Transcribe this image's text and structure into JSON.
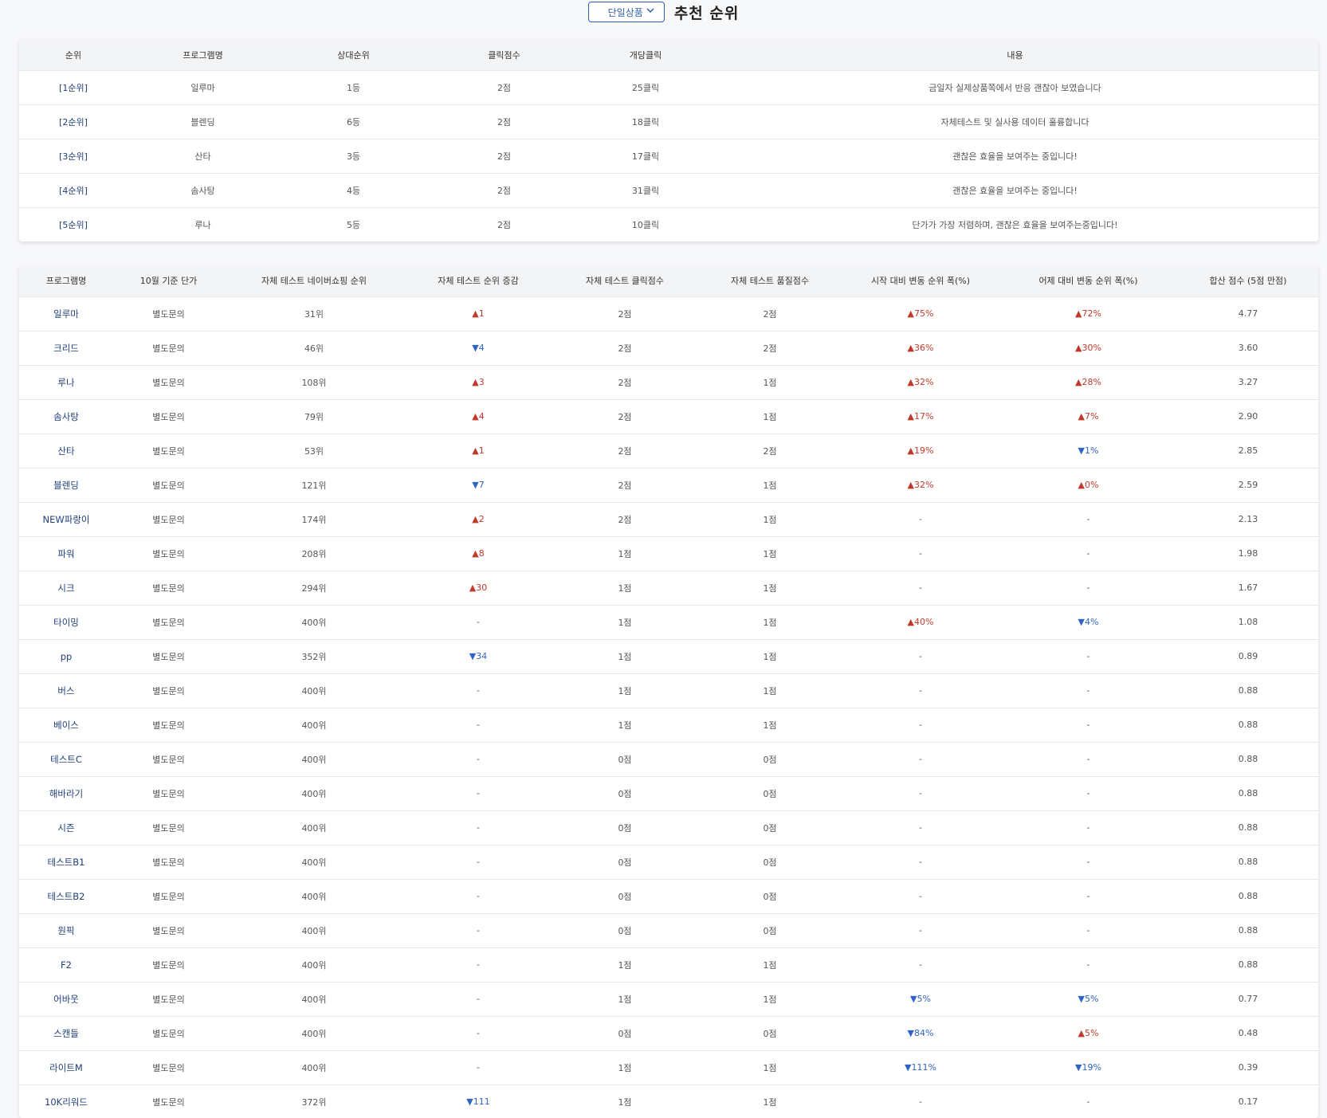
{
  "header": {
    "dropdown_label": "단일상품",
    "title": "추천 순위"
  },
  "top_table": {
    "columns": [
      "순위",
      "프로그램명",
      "상대순위",
      "클릭점수",
      "개당클릭",
      "내용"
    ],
    "rows": [
      [
        "[1순위]",
        "일루마",
        "1등",
        "2점",
        "25클릭",
        "금일자 실제상품쪽에서 반응 괜찮아 보였습니다"
      ],
      [
        "[2순위]",
        "블렌딩",
        "6등",
        "2점",
        "18클릭",
        "자체테스트 및 실사용 데이터 훌륭합니다"
      ],
      [
        "[3순위]",
        "산타",
        "3등",
        "2점",
        "17클릭",
        "괜찮은 효율을 보여주는 중입니다!"
      ],
      [
        "[4순위]",
        "솜사탕",
        "4등",
        "2점",
        "31클릭",
        "괜찮은 효율을 보여주는 중입니다!"
      ],
      [
        "[5순위]",
        "루나",
        "5등",
        "2점",
        "10클릭",
        "단가가 가장 저렴하며, 괜찮은 효율을 보여주는중입니다!"
      ]
    ]
  },
  "bottom_table": {
    "columns": [
      "프로그램명",
      "10월 기준 단가",
      "자체 테스트 네이버쇼핑 순위",
      "자체 테스트 순위 증감",
      "자체 테스트 클릭점수",
      "자체 테스트 품질점수",
      "시작 대비 변동 순위 폭(%)",
      "어제 대비 변동 순위 폭(%)",
      "합산 점수 (5점 만점)"
    ],
    "rows": [
      [
        "일루마",
        "별도문의",
        "31위",
        "▲1",
        "2점",
        "2점",
        "▲75%",
        "▲72%",
        "4.77"
      ],
      [
        "크리드",
        "별도문의",
        "46위",
        "▼4",
        "2점",
        "2점",
        "▲36%",
        "▲30%",
        "3.60"
      ],
      [
        "루나",
        "별도문의",
        "108위",
        "▲3",
        "2점",
        "1점",
        "▲32%",
        "▲28%",
        "3.27"
      ],
      [
        "솜사탕",
        "별도문의",
        "79위",
        "▲4",
        "2점",
        "1점",
        "▲17%",
        "▲7%",
        "2.90"
      ],
      [
        "산타",
        "별도문의",
        "53위",
        "▲1",
        "2점",
        "2점",
        "▲19%",
        "▼1%",
        "2.85"
      ],
      [
        "블렌딩",
        "별도문의",
        "121위",
        "▼7",
        "2점",
        "1점",
        "▲32%",
        "▲0%",
        "2.59"
      ],
      [
        "NEW파랑이",
        "별도문의",
        "174위",
        "▲2",
        "2점",
        "1점",
        "-",
        "-",
        "2.13"
      ],
      [
        "파워",
        "별도문의",
        "208위",
        "▲8",
        "1점",
        "1점",
        "-",
        "-",
        "1.98"
      ],
      [
        "시크",
        "별도문의",
        "294위",
        "▲30",
        "1점",
        "1점",
        "-",
        "-",
        "1.67"
      ],
      [
        "타이밍",
        "별도문의",
        "400위",
        "-",
        "1점",
        "1점",
        "▲40%",
        "▼4%",
        "1.08"
      ],
      [
        "pp",
        "별도문의",
        "352위",
        "▼34",
        "1점",
        "1점",
        "-",
        "-",
        "0.89"
      ],
      [
        "버스",
        "별도문의",
        "400위",
        "-",
        "1점",
        "1점",
        "-",
        "-",
        "0.88"
      ],
      [
        "베이스",
        "별도문의",
        "400위",
        "-",
        "1점",
        "1점",
        "-",
        "-",
        "0.88"
      ],
      [
        "테스트C",
        "별도문의",
        "400위",
        "-",
        "0점",
        "0점",
        "-",
        "-",
        "0.88"
      ],
      [
        "해바라기",
        "별도문의",
        "400위",
        "-",
        "0점",
        "0점",
        "-",
        "-",
        "0.88"
      ],
      [
        "시즌",
        "별도문의",
        "400위",
        "-",
        "0점",
        "0점",
        "-",
        "-",
        "0.88"
      ],
      [
        "테스트B1",
        "별도문의",
        "400위",
        "-",
        "0점",
        "0점",
        "-",
        "-",
        "0.88"
      ],
      [
        "테스트B2",
        "별도문의",
        "400위",
        "-",
        "0점",
        "0점",
        "-",
        "-",
        "0.88"
      ],
      [
        "원픽",
        "별도문의",
        "400위",
        "-",
        "0점",
        "0점",
        "-",
        "-",
        "0.88"
      ],
      [
        "F2",
        "별도문의",
        "400위",
        "-",
        "1점",
        "1점",
        "-",
        "-",
        "0.88"
      ],
      [
        "어바웃",
        "별도문의",
        "400위",
        "-",
        "1점",
        "1점",
        "▼5%",
        "▼5%",
        "0.77"
      ],
      [
        "스캔들",
        "별도문의",
        "400위",
        "-",
        "0점",
        "0점",
        "▼84%",
        "▲5%",
        "0.48"
      ],
      [
        "라이트M",
        "별도문의",
        "400위",
        "-",
        "1점",
        "1점",
        "▼111%",
        "▼19%",
        "0.39"
      ],
      [
        "10K리워드",
        "별도문의",
        "372위",
        "▼111",
        "1점",
        "1점",
        "-",
        "-",
        "0.17"
      ]
    ]
  },
  "colors": {
    "up": "#c0392b",
    "down": "#2f63c4",
    "link": "#1f3f7a",
    "accent": "#2f5fa8"
  },
  "icons": {
    "dropdown": "chevron-down-icon"
  }
}
